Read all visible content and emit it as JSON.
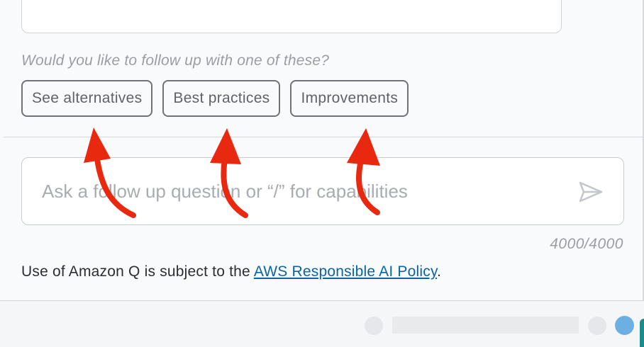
{
  "followup": {
    "prompt": "Would you like to follow up with one of these?",
    "chips": [
      "See alternatives",
      "Best practices",
      "Improvements"
    ]
  },
  "input": {
    "placeholder": "Ask a follow up question or “/” for capabilities",
    "value": "",
    "counter": "4000/4000"
  },
  "footer": {
    "policy_prefix": "Use of Amazon Q is subject to the ",
    "policy_link": "AWS Responsible AI Policy",
    "policy_suffix": "."
  },
  "annotations": {
    "arrow_color": "#e8280f"
  },
  "colors": {
    "link": "#0b63a6",
    "status_dot": "#6cb0e3",
    "accent_corner": "#1a8c8e"
  }
}
